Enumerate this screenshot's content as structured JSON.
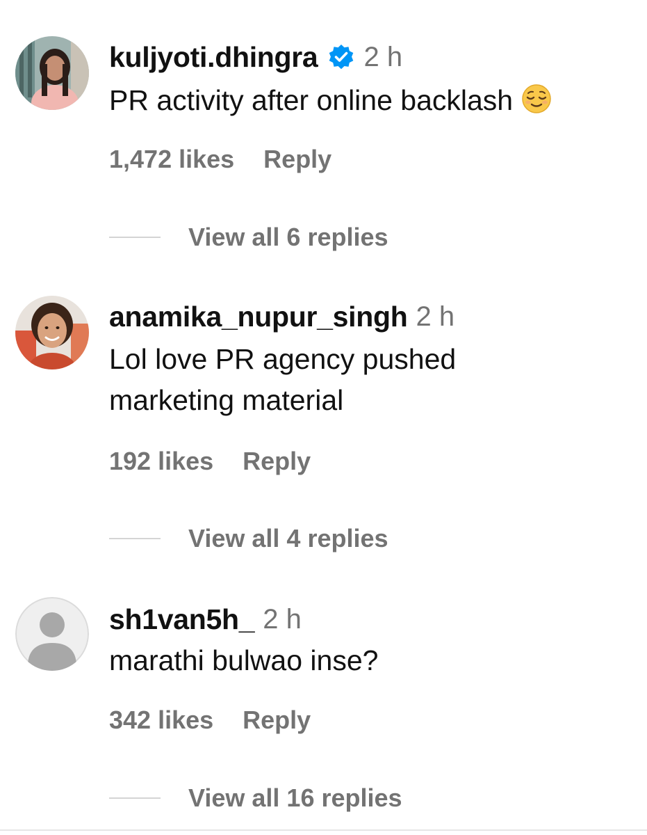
{
  "comments": [
    {
      "username": "kuljyoti.dhingra",
      "verified": true,
      "time": "2 h",
      "text": "PR activity after online backlash",
      "emoji": "relieved-face",
      "likes": "1,472 likes",
      "reply": "Reply",
      "view_replies": "View all 6 replies"
    },
    {
      "username": "anamika_nupur_singh",
      "verified": false,
      "time": "2 h",
      "text_line1": "Lol love PR agency pushed",
      "text_line2": "marketing material",
      "likes": "192 likes",
      "reply": "Reply",
      "view_replies": "View all 4 replies"
    },
    {
      "username": "sh1van5h_",
      "verified": false,
      "time": "2 h",
      "text": "marathi bulwao inse?",
      "avatar": "default-avatar",
      "likes": "342 likes",
      "reply": "Reply",
      "view_replies": "View all 16 replies"
    }
  ],
  "colors": {
    "text": "#111111",
    "secondary": "#737373",
    "verified": "#0095f6",
    "divider": "#d4d4d4"
  }
}
